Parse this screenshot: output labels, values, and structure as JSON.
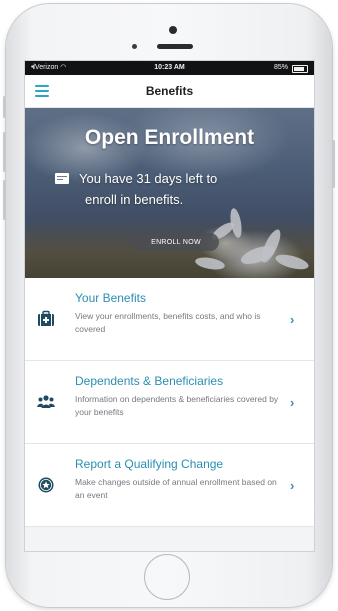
{
  "status_bar": {
    "carrier": "Verizon",
    "time": "10:23 AM",
    "battery": "85%"
  },
  "nav": {
    "title": "Benefits",
    "menu_icon": "hamburger-menu-icon"
  },
  "hero": {
    "title": "Open Enrollment",
    "message_line1": "You have 31 days left to",
    "message_line2": "enroll in benefits.",
    "calendar_icon": "calendar-icon",
    "button_label": "ENROLL NOW"
  },
  "list": [
    {
      "title": "Your Benefits",
      "description": "View your enrollments, benefits costs, and who is covered",
      "icon": "medical-kit-icon"
    },
    {
      "title": "Dependents & Beneficiaries",
      "description": "Information on dependents & beneficiaries covered by your benefits",
      "icon": "group-people-icon"
    },
    {
      "title": "Report a Qualifying Change",
      "description": "Make changes outside of annual enrollment based on an event",
      "icon": "star-badge-icon"
    }
  ],
  "colors": {
    "accent": "#2a8fb3",
    "icon_dark": "#1f4a60",
    "nav_menu": "#2aa6c6"
  }
}
